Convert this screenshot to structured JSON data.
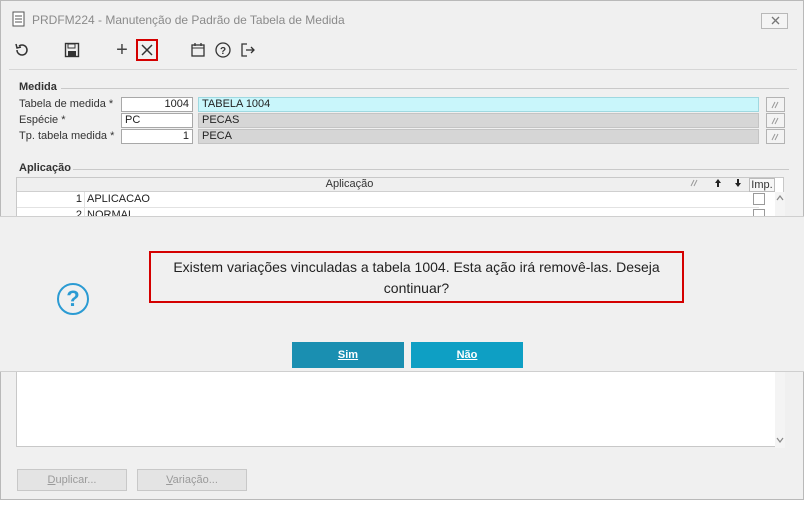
{
  "window": {
    "title": "PRDFM224 - Manutenção de Padrão de Tabela de Medida",
    "close_label": "✕"
  },
  "toolbar": {
    "refresh": "↻",
    "save": "save",
    "add": "+",
    "delete": "✕",
    "calendar": "calendar",
    "help": "?",
    "exit": "exit"
  },
  "medida": {
    "group_label": "Medida",
    "fields": [
      {
        "label": "Tabela de medida *",
        "value": "1004",
        "description": "TABELA 1004"
      },
      {
        "label": "Espécie *",
        "value": "PC",
        "description": "PECAS"
      },
      {
        "label": "Tp. tabela medida *",
        "value": "1",
        "description": "PECA"
      }
    ]
  },
  "aplicacao": {
    "group_label": "Aplicação",
    "columns": {
      "aplicacao": "Aplicação",
      "imp": "Imp."
    },
    "rows": [
      {
        "num": "1",
        "text": "APLICACAO"
      },
      {
        "num": "2",
        "text": "NORMAL"
      }
    ]
  },
  "buttons": {
    "duplicar_u": "D",
    "duplicar_rest": "uplicar...",
    "variacao_u": "V",
    "variacao_rest": "ariação..."
  },
  "dialog": {
    "icon": "?",
    "message_line1": "Existem variações vinculadas a tabela 1004. Esta ação irá removê-las. Deseja",
    "message_line2": "continuar?",
    "yes_label": "Sim",
    "no_label": "Não"
  },
  "colors": {
    "accent": "#1a8fb1",
    "highlight": "#d40000"
  }
}
